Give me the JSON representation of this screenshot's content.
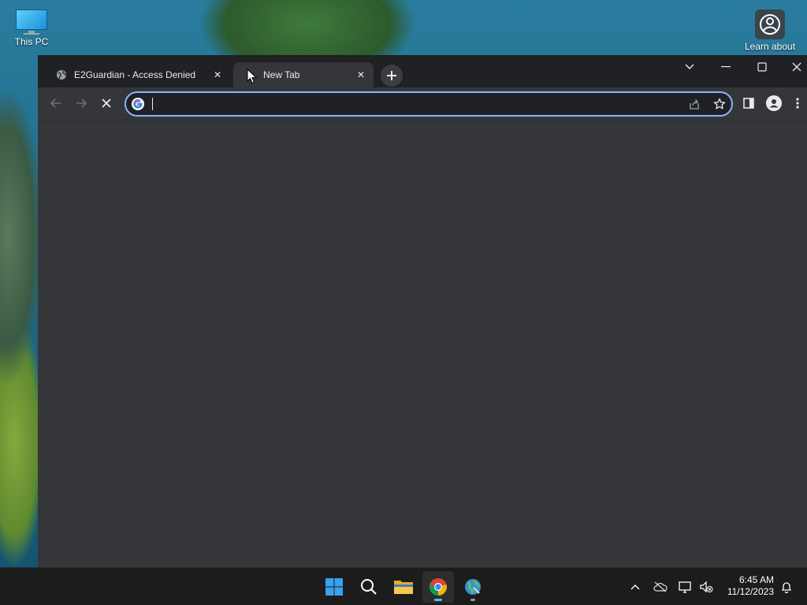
{
  "desktop": {
    "icons": [
      {
        "label": "This PC",
        "icon": "monitor-icon"
      },
      {
        "label": "Learn about",
        "icon": "learn-about-icon"
      }
    ]
  },
  "browser": {
    "tabs": [
      {
        "title": "E2Guardian - Access Denied",
        "icon": "globe-icon",
        "active": false
      },
      {
        "title": "New Tab",
        "icon": "loading-icon",
        "active": true
      }
    ],
    "omnibox": {
      "value": "",
      "placeholder": ""
    },
    "colors": {
      "accent": "#8ab4f8",
      "background": "#35363a",
      "tabstrip": "#202124"
    }
  },
  "taskbar": {
    "apps": [
      {
        "name": "Start",
        "icon": "windows-start-icon"
      },
      {
        "name": "Search",
        "icon": "search-icon"
      },
      {
        "name": "File Explorer",
        "icon": "folder-icon"
      },
      {
        "name": "Google Chrome",
        "icon": "chrome-icon",
        "active": true
      },
      {
        "name": "Globe app",
        "icon": "globe-app-icon"
      }
    ],
    "clock": {
      "time": "6:45 AM",
      "date": "11/12/2023"
    }
  }
}
